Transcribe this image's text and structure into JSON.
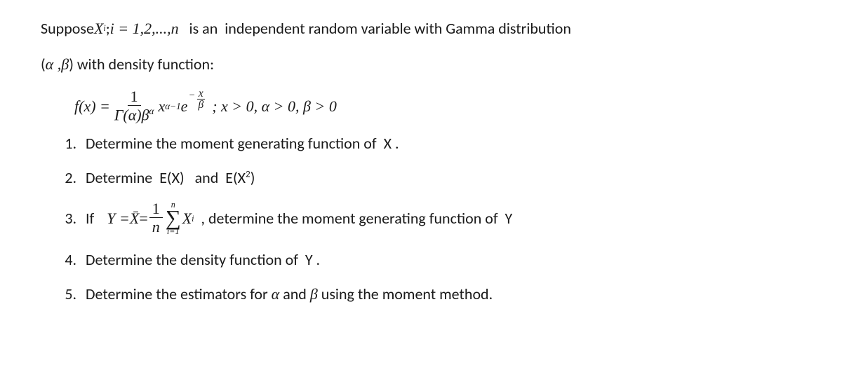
{
  "intro": {
    "p1a": "Suppose ",
    "p1_var": "X",
    "p1_sub": "i",
    "p1_semi": " ;",
    "p1_cond": " i = 1,2,...,n",
    "p1b": "   is an  independent random variable with Gamma distribution",
    "p2a": "(",
    "p2_alpha": "α ,β",
    "p2b": ") with density function:"
  },
  "fx": {
    "lhs": "f(x) =",
    "num1": "1",
    "den1_gamma": "Γ(α)β",
    "den1_exp": "α",
    "mid1": "x",
    "mid1_exp": "α−1",
    "e": " e",
    "exp_top_sign": "−",
    "exp_top_num": "x",
    "exp_top_den": "β",
    "tail": " ; x > 0, α > 0, β > 0"
  },
  "q1": "Determine the moment generating function of  X .",
  "q2_a": "Determine  E(X)   and  E(X",
  "q2_sup": "2",
  "q2_b": ")",
  "q3": {
    "a": "If",
    "Ydef1": "Y = ",
    "Xbar": "X̄",
    "eq2": " = ",
    "frac_num": "1",
    "frac_den": "n",
    "sum_top": "n",
    "sum_bot": "i=1",
    "Xi": "X",
    "Xi_sub": "i",
    "tail": "  , determine the moment generating function of  Y"
  },
  "q4": "Determine the density function of  Y .",
  "q5_a": "Determine the estimators for ",
  "q5_alpha": "α",
  "q5_and": " and ",
  "q5_beta": "β",
  "q5_b": " using the moment method."
}
